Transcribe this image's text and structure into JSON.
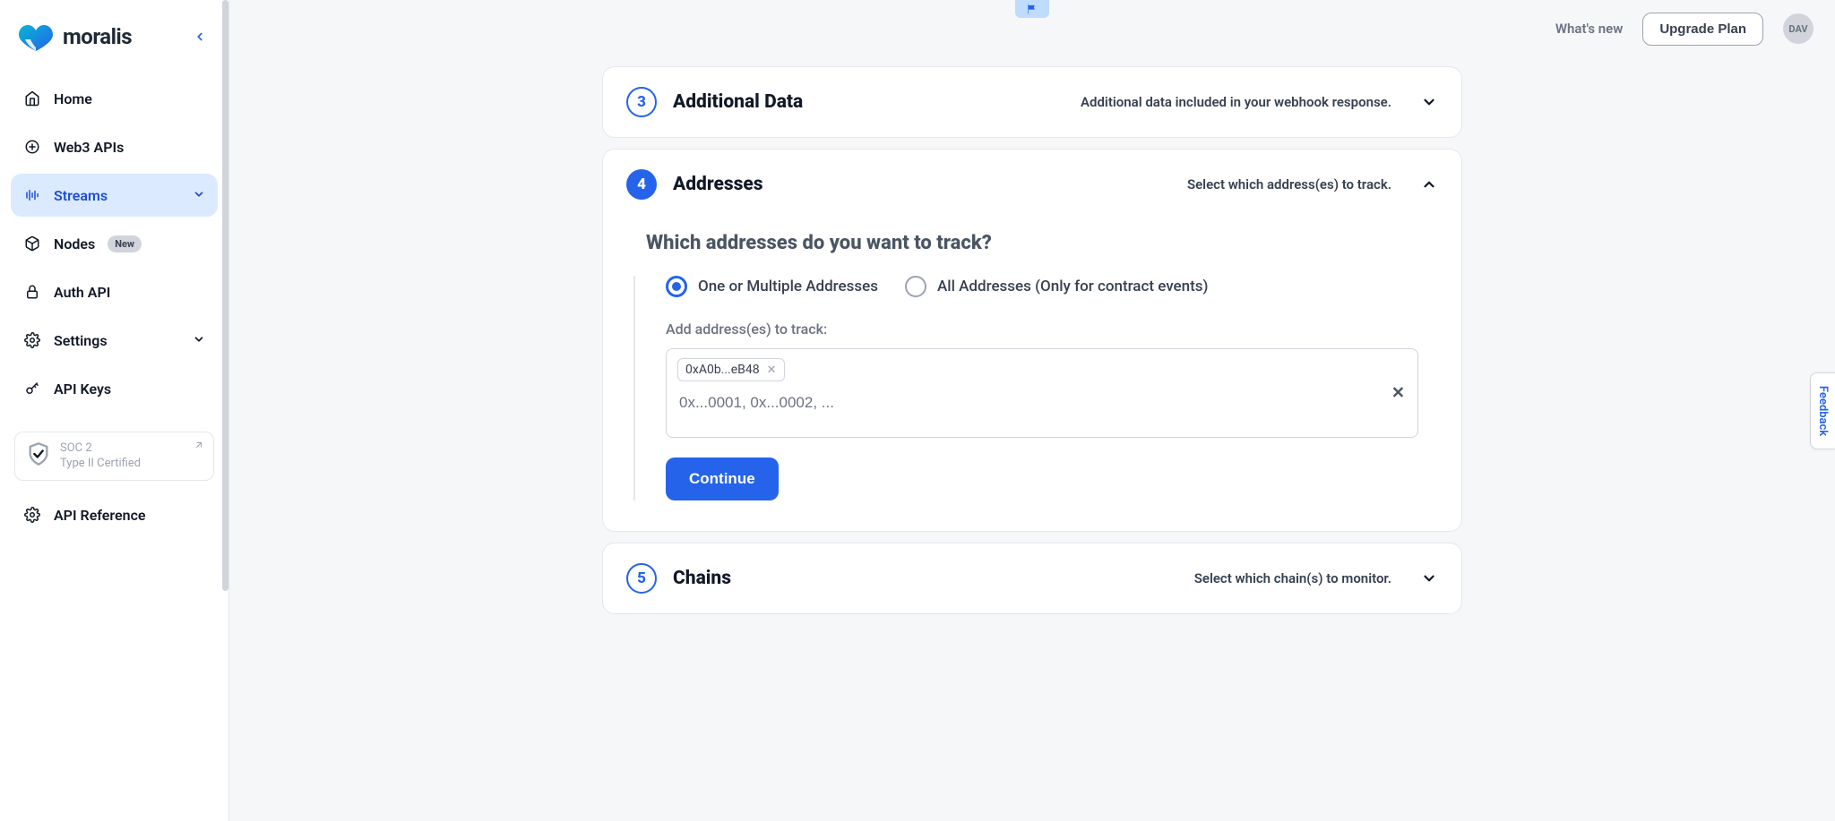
{
  "brand": {
    "name": "moralis"
  },
  "sidebar": {
    "items": [
      {
        "label": "Home"
      },
      {
        "label": "Web3 APIs"
      },
      {
        "label": "Streams"
      },
      {
        "label": "Nodes",
        "badge": "New"
      },
      {
        "label": "Auth API"
      },
      {
        "label": "Settings"
      },
      {
        "label": "API Keys"
      }
    ],
    "soc": {
      "line1": "SOC 2",
      "line2": "Type II Certified"
    },
    "api_reference": "API Reference"
  },
  "topbar": {
    "whats_new": "What's new",
    "upgrade": "Upgrade Plan",
    "avatar": "DAV"
  },
  "steps": {
    "s3": {
      "num": "3",
      "title": "Additional Data",
      "subtitle": "Additional data included in your webhook response."
    },
    "s4": {
      "num": "4",
      "title": "Addresses",
      "subtitle": "Select which address(es) to track.",
      "question": "Which addresses do you want to track?",
      "opt1": "One or Multiple Addresses",
      "opt2": "All Addresses (Only for contract events)",
      "field_label": "Add address(es) to track:",
      "tag": "0xA0b...eB48",
      "placeholder": "0x...0001, 0x...0002, ...",
      "continue": "Continue"
    },
    "s5": {
      "num": "5",
      "title": "Chains",
      "subtitle": "Select which chain(s) to monitor."
    }
  },
  "feedback": "Feedback"
}
